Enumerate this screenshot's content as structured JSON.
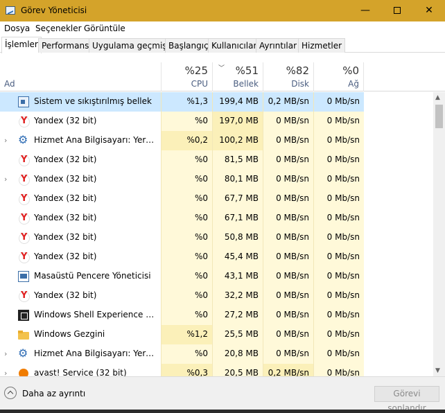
{
  "window": {
    "title": "Görev Yöneticisi",
    "minimize": "—",
    "close": "✕"
  },
  "menu": [
    "Dosya",
    "Seçenekler",
    "Görüntüle"
  ],
  "tabs": [
    "İşlemler",
    "Performans",
    "Uygulama geçmişi",
    "Başlangıç",
    "Kullanıcılar",
    "Ayrıntılar",
    "Hizmetler"
  ],
  "columns": {
    "name": "Ad",
    "cpu": {
      "pct": "%25",
      "label": "CPU"
    },
    "mem": {
      "pct": "%51",
      "label": "Bellek"
    },
    "disk": {
      "pct": "%82",
      "label": "Disk"
    },
    "net": {
      "pct": "%0",
      "label": "Ağ"
    }
  },
  "processes": [
    {
      "name": "Sistem ve sıkıştırılmış bellek",
      "icon": "memory-icon",
      "expandable": false,
      "cpu": "%1,3",
      "mem": "199,4 MB",
      "disk": "0,2 MB/sn",
      "net": "0 Mb/sn",
      "selected": true
    },
    {
      "name": "Yandex (32 bit)",
      "icon": "yandex-icon",
      "expandable": false,
      "cpu": "%0",
      "mem": "197,0 MB",
      "disk": "0 MB/sn",
      "net": "0 Mb/sn"
    },
    {
      "name": "Hizmet Ana Bilgisayarı: Yerel Sis...",
      "icon": "gear-icon",
      "expandable": true,
      "cpu": "%0,2",
      "mem": "100,2 MB",
      "disk": "0 MB/sn",
      "net": "0 Mb/sn"
    },
    {
      "name": "Yandex (32 bit)",
      "icon": "yandex-icon",
      "expandable": false,
      "cpu": "%0",
      "mem": "81,5 MB",
      "disk": "0 MB/sn",
      "net": "0 Mb/sn"
    },
    {
      "name": "Yandex (32 bit)",
      "icon": "yandex-icon",
      "expandable": true,
      "cpu": "%0",
      "mem": "80,1 MB",
      "disk": "0 MB/sn",
      "net": "0 Mb/sn"
    },
    {
      "name": "Yandex (32 bit)",
      "icon": "yandex-icon",
      "expandable": false,
      "cpu": "%0",
      "mem": "67,7 MB",
      "disk": "0 MB/sn",
      "net": "0 Mb/sn"
    },
    {
      "name": "Yandex (32 bit)",
      "icon": "yandex-icon",
      "expandable": false,
      "cpu": "%0",
      "mem": "67,1 MB",
      "disk": "0 MB/sn",
      "net": "0 Mb/sn"
    },
    {
      "name": "Yandex (32 bit)",
      "icon": "yandex-icon",
      "expandable": false,
      "cpu": "%0",
      "mem": "50,8 MB",
      "disk": "0 MB/sn",
      "net": "0 Mb/sn"
    },
    {
      "name": "Yandex (32 bit)",
      "icon": "yandex-icon",
      "expandable": false,
      "cpu": "%0",
      "mem": "45,4 MB",
      "disk": "0 MB/sn",
      "net": "0 Mb/sn"
    },
    {
      "name": "Masaüstü Pencere Yöneticisi",
      "icon": "window-manager-icon",
      "expandable": false,
      "cpu": "%0",
      "mem": "43,1 MB",
      "disk": "0 MB/sn",
      "net": "0 Mb/sn"
    },
    {
      "name": "Yandex (32 bit)",
      "icon": "yandex-icon",
      "expandable": false,
      "cpu": "%0",
      "mem": "32,2 MB",
      "disk": "0 MB/sn",
      "net": "0 Mb/sn"
    },
    {
      "name": "Windows Shell Experience Host",
      "icon": "shell-icon",
      "expandable": false,
      "cpu": "%0",
      "mem": "27,2 MB",
      "disk": "0 MB/sn",
      "net": "0 Mb/sn"
    },
    {
      "name": "Windows Gezgini",
      "icon": "folder-icon",
      "expandable": false,
      "cpu": "%1,2",
      "mem": "25,5 MB",
      "disk": "0 MB/sn",
      "net": "0 Mb/sn"
    },
    {
      "name": "Hizmet Ana Bilgisayarı: Yerel Sis...",
      "icon": "gear-icon",
      "expandable": true,
      "cpu": "%0",
      "mem": "20,8 MB",
      "disk": "0 MB/sn",
      "net": "0 Mb/sn"
    },
    {
      "name": "avast! Service (32 bit)",
      "icon": "avast-icon",
      "expandable": true,
      "cpu": "%0,3",
      "mem": "20,5 MB",
      "disk": "0,2 MB/sn",
      "net": "0 Mb/sn"
    }
  ],
  "footer": {
    "fewer_details": "Daha az ayrıntı",
    "end_task": "Görevi sonlandır"
  },
  "colors": {
    "titlebar": "#d4a32a",
    "selected_row": "#cce8ff",
    "heat_light": "#fff9d9",
    "heat_medium": "#fbf0b9"
  }
}
